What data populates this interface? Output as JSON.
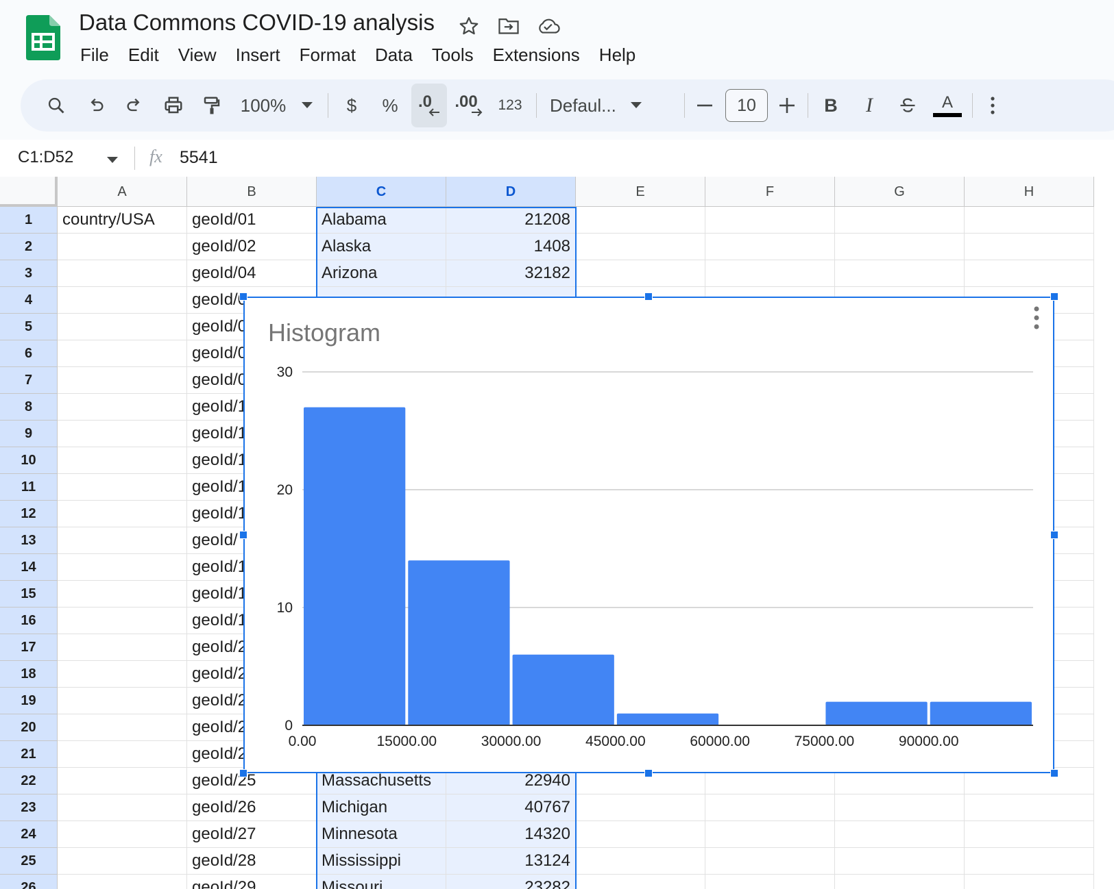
{
  "app": {
    "doc_title": "Data Commons COVID-19 analysis",
    "menu": [
      "File",
      "Edit",
      "View",
      "Insert",
      "Format",
      "Data",
      "Tools",
      "Extensions",
      "Help"
    ]
  },
  "toolbar": {
    "zoom": "100%",
    "currency": "$",
    "percent": "%",
    "decrease_decimal": ".0",
    "increase_decimal": ".00",
    "number_format": "123",
    "font": "Defaul...",
    "font_size": "10",
    "bold": "B",
    "italic": "I",
    "text_color_glyph": "A",
    "text_color": "#000000"
  },
  "formula_bar": {
    "name_box": "C1:D52",
    "fx": "fx",
    "value": "5541"
  },
  "sheet": {
    "columns": [
      "A",
      "B",
      "C",
      "D",
      "E",
      "F",
      "G",
      "H"
    ],
    "selected_columns": [
      "C",
      "D"
    ],
    "rows": [
      {
        "n": "1",
        "a": "country/USA",
        "b": "geoId/01",
        "c": "Alabama",
        "d": "21208"
      },
      {
        "n": "2",
        "a": "",
        "b": "geoId/02",
        "c": "Alaska",
        "d": "1408"
      },
      {
        "n": "3",
        "a": "",
        "b": "geoId/04",
        "c": "Arizona",
        "d": "32182"
      },
      {
        "n": "4",
        "a": "",
        "b": "geoId/0",
        "c": "",
        "d": ""
      },
      {
        "n": "5",
        "a": "",
        "b": "geoId/0",
        "c": "",
        "d": ""
      },
      {
        "n": "6",
        "a": "",
        "b": "geoId/0",
        "c": "",
        "d": ""
      },
      {
        "n": "7",
        "a": "",
        "b": "geoId/0",
        "c": "",
        "d": ""
      },
      {
        "n": "8",
        "a": "",
        "b": "geoId/1",
        "c": "",
        "d": ""
      },
      {
        "n": "9",
        "a": "",
        "b": "geoId/1",
        "c": "",
        "d": ""
      },
      {
        "n": "10",
        "a": "",
        "b": "geoId/1",
        "c": "",
        "d": ""
      },
      {
        "n": "11",
        "a": "",
        "b": "geoId/1",
        "c": "",
        "d": ""
      },
      {
        "n": "12",
        "a": "",
        "b": "geoId/1",
        "c": "",
        "d": ""
      },
      {
        "n": "13",
        "a": "",
        "b": "geoId/",
        "c": "",
        "d": ""
      },
      {
        "n": "14",
        "a": "",
        "b": "geoId/1",
        "c": "",
        "d": ""
      },
      {
        "n": "15",
        "a": "",
        "b": "geoId/1",
        "c": "",
        "d": ""
      },
      {
        "n": "16",
        "a": "",
        "b": "geoId/1",
        "c": "",
        "d": ""
      },
      {
        "n": "17",
        "a": "",
        "b": "geoId/2",
        "c": "",
        "d": ""
      },
      {
        "n": "18",
        "a": "",
        "b": "geoId/2",
        "c": "",
        "d": ""
      },
      {
        "n": "19",
        "a": "",
        "b": "geoId/2",
        "c": "",
        "d": ""
      },
      {
        "n": "20",
        "a": "",
        "b": "geoId/2",
        "c": "",
        "d": ""
      },
      {
        "n": "21",
        "a": "",
        "b": "geoId/2",
        "c": "",
        "d": ""
      },
      {
        "n": "22",
        "a": "",
        "b": "geoId/25",
        "c": "Massachusetts",
        "d": "22940"
      },
      {
        "n": "23",
        "a": "",
        "b": "geoId/26",
        "c": "Michigan",
        "d": "40767"
      },
      {
        "n": "24",
        "a": "",
        "b": "geoId/27",
        "c": "Minnesota",
        "d": "14320"
      },
      {
        "n": "25",
        "a": "",
        "b": "geoId/28",
        "c": "Mississippi",
        "d": "13124"
      },
      {
        "n": "26",
        "a": "",
        "b": "geoId/29",
        "c": "Missouri",
        "d": "23282"
      }
    ]
  },
  "chart_data": {
    "type": "bar",
    "title": "Histogram",
    "xlabel": "",
    "ylabel": "",
    "bins": [
      {
        "from": 0,
        "to": 15000,
        "count": 27
      },
      {
        "from": 15000,
        "to": 30000,
        "count": 14
      },
      {
        "from": 30000,
        "to": 45000,
        "count": 6
      },
      {
        "from": 45000,
        "to": 60000,
        "count": 1
      },
      {
        "from": 60000,
        "to": 75000,
        "count": 0
      },
      {
        "from": 75000,
        "to": 90000,
        "count": 2
      },
      {
        "from": 90000,
        "to": 105000,
        "count": 2
      }
    ],
    "x_tick_labels": [
      "0.00",
      "15000.00",
      "30000.00",
      "45000.00",
      "60000.00",
      "75000.00",
      "90000.00"
    ],
    "y_tick_labels": [
      "0",
      "10",
      "20",
      "30"
    ],
    "ylim": [
      0,
      30
    ],
    "xlim": [
      0,
      105000
    ],
    "bar_color": "#4285f4",
    "grid": true,
    "legend": "none"
  }
}
